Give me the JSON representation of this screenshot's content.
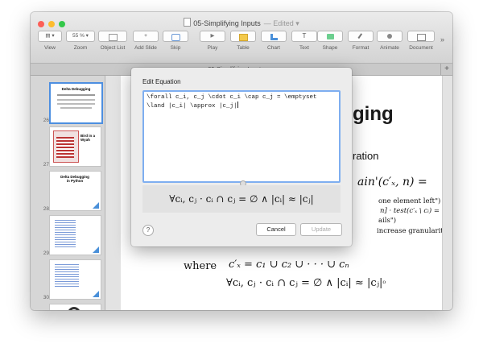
{
  "window": {
    "title": "05-Simplifying Inputs",
    "subtitle": "— Edited ▾",
    "traffic_lights": [
      "#fc5f57",
      "#fdbc2f",
      "#34c84a"
    ]
  },
  "toolbar": {
    "items": [
      {
        "id": "view",
        "label": "View",
        "control": "▤ ▾",
        "icon": "view-icon"
      },
      {
        "id": "zoom",
        "label": "Zoom",
        "control": "55 % ▾",
        "icon": "zoom-icon"
      },
      {
        "id": "object-list",
        "label": "Object List",
        "control": "",
        "icon": "object-list-icon"
      },
      {
        "id": "add-slide",
        "label": "Add Slide",
        "control": "+",
        "icon": "add-slide-icon"
      },
      {
        "id": "skip",
        "label": "Skip",
        "control": "",
        "icon": "skip-icon"
      },
      {
        "id": "play",
        "label": "Play",
        "control": "▶",
        "icon": "play-icon"
      },
      {
        "id": "table",
        "label": "Table",
        "control": "",
        "icon": "table-icon"
      },
      {
        "id": "chart",
        "label": "Chart",
        "control": "",
        "icon": "chart-icon"
      },
      {
        "id": "text",
        "label": "Text",
        "control": "T",
        "icon": "text-icon"
      },
      {
        "id": "shape",
        "label": "Shape",
        "control": "",
        "icon": "shape-icon"
      },
      {
        "id": "format",
        "label": "Format",
        "control": "",
        "icon": "format-icon"
      },
      {
        "id": "animate",
        "label": "Animate",
        "control": "",
        "icon": "animate-icon"
      },
      {
        "id": "document",
        "label": "Document",
        "control": "",
        "icon": "document-icon"
      }
    ],
    "overflow": "»"
  },
  "tab": {
    "label": "05-Simplifying Inputs",
    "add": "+"
  },
  "slide_navigator": {
    "slides": [
      {
        "number": "26",
        "title": "Delta Debugging",
        "selected": true
      },
      {
        "number": "27",
        "title": "Delta Debugging",
        "side_text": "Bird in a Wyah"
      },
      {
        "number": "28",
        "title": "Delta Debugging in Python"
      },
      {
        "number": "29",
        "title": ""
      },
      {
        "number": "30",
        "title": ""
      },
      {
        "number": "",
        "title": ""
      }
    ]
  },
  "slide": {
    "title_fragment": "ging",
    "line_ration": "ration",
    "formula_head": "ain'(c′ₓ, n) =",
    "line_one_element": "one element left\")",
    "line_test": "n] · test(c′ₓ \\ cᵢ) = ✘",
    "line_ails": "ails\")",
    "line_granularity": "increase granularity\")",
    "where_label": "where",
    "where_formula": "c′ₓ = c₁ ∪ c₂ ∪ · · · ∪ cₙ",
    "last_formula": "∀cᵢ, cⱼ · cᵢ ∩ cⱼ = ∅ ∧ |cᵢ| ≈ |cⱼ|",
    "last_suffix": "⁰",
    "cross_color": "#e02020"
  },
  "dialog": {
    "title": "Edit Equation",
    "latex_line1": "\\forall c_i, c_j \\cdot c_i \\cap c_j = \\emptyset",
    "latex_line2": "\\land |c_i| \\approx |c_j|",
    "preview": "∀cᵢ, cⱼ · cᵢ ∩ cⱼ = ∅ ∧ |cᵢ| ≈ |cⱼ|",
    "help": "?",
    "cancel": "Cancel",
    "update": "Update"
  }
}
